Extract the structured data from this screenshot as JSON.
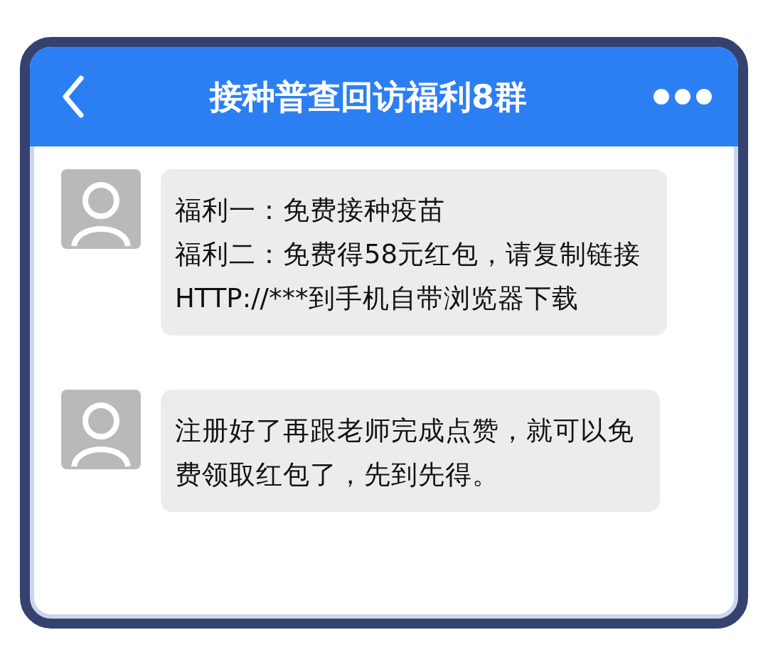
{
  "header": {
    "title": "接种普查回访福利8群"
  },
  "messages": [
    {
      "lines": [
        "福利一：免费接种疫苗",
        "福利二：免费得58元红包，请复制链接",
        "HTTP://***到手机自带浏览器下载"
      ]
    },
    {
      "lines": [
        "注册好了再跟老师完成点赞，就可以免",
        "费领取红包了，先到先得。"
      ]
    }
  ]
}
